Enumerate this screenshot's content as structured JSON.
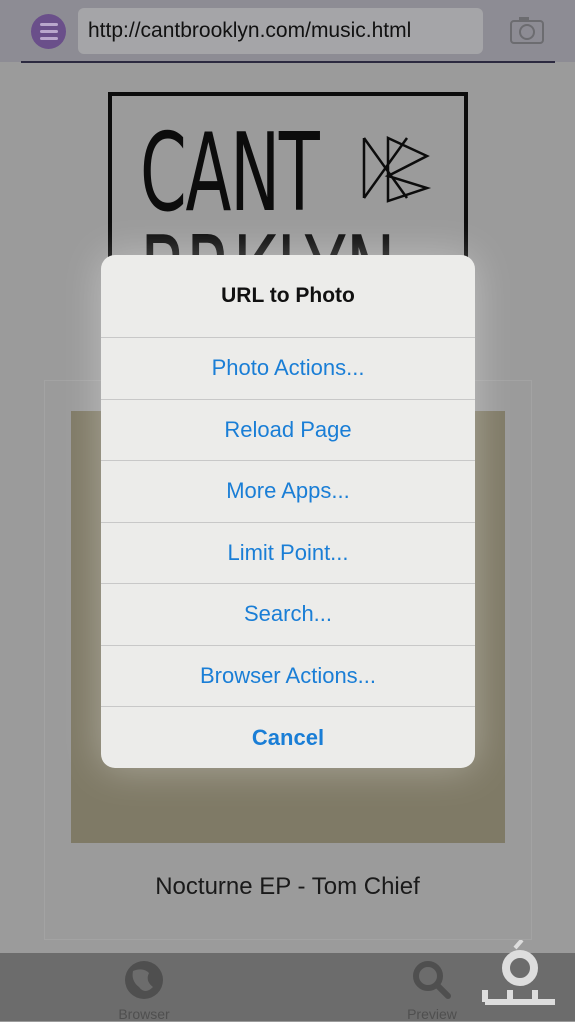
{
  "browser": {
    "url": "http://cantbrooklyn.com/music.html"
  },
  "page": {
    "logo_line1": "CANT",
    "logo_line2": "BRKLYN",
    "caption": "Nocturne EP - Tom Chief"
  },
  "tabbar": {
    "items": [
      {
        "label": "Browser",
        "icon": "globe-icon"
      },
      {
        "label": "Preview",
        "icon": "search-icon"
      }
    ]
  },
  "dialog": {
    "title": "URL to Photo",
    "options": [
      "Photo Actions...",
      "Reload Page",
      "More Apps...",
      "Limit Point...",
      "Search...",
      "Browser Actions...",
      "Cancel"
    ]
  },
  "colors": {
    "accent": "#1a7ed6",
    "menu": "#6a4f8a"
  }
}
